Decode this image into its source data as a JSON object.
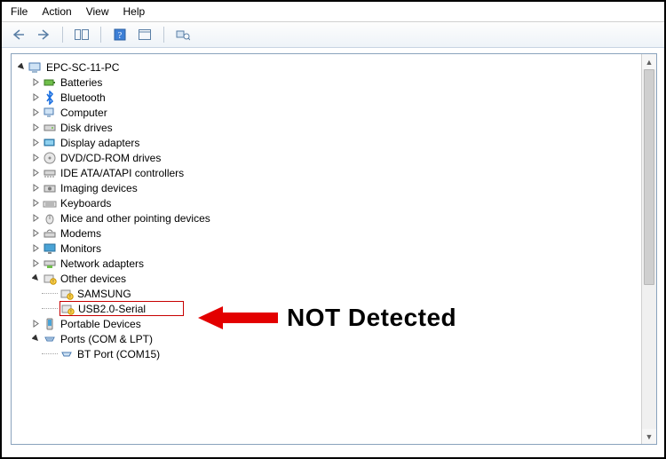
{
  "menu": {
    "file": "File",
    "action": "Action",
    "view": "View",
    "help": "Help"
  },
  "root": {
    "label": "EPC-SC-11-PC"
  },
  "nodes": {
    "batteries": "Batteries",
    "bluetooth": "Bluetooth",
    "computer": "Computer",
    "disk": "Disk drives",
    "display": "Display adapters",
    "dvd": "DVD/CD-ROM drives",
    "ide": "IDE ATA/ATAPI controllers",
    "imaging": "Imaging devices",
    "keyboards": "Keyboards",
    "mice": "Mice and other pointing devices",
    "modems": "Modems",
    "monitors": "Monitors",
    "network": "Network adapters",
    "other": "Other devices",
    "other_samsung": "SAMSUNG",
    "other_usbserial": "USB2.0-Serial",
    "portable": "Portable Devices",
    "ports": "Ports (COM & LPT)",
    "ports_bt": "BT Port (COM15)"
  },
  "annotation": {
    "text": "NOT Detected"
  }
}
